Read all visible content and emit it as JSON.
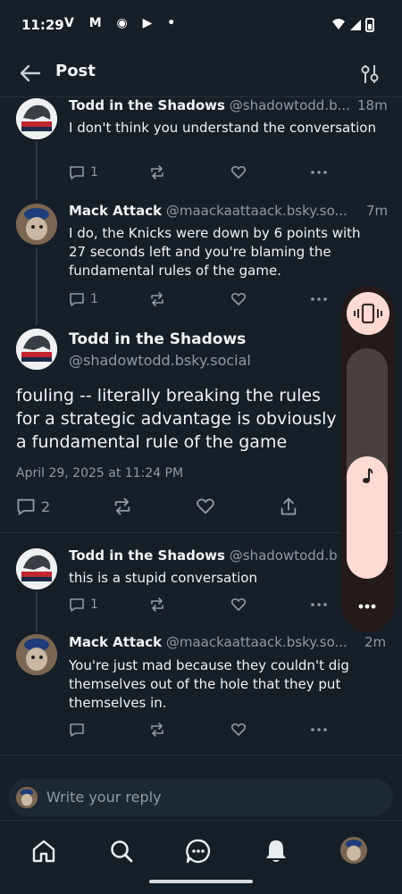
{
  "status_bar": {
    "time": "11:29",
    "icons": "V M ◉ ▶ •",
    "right_icons": "▾ ◢ ▮"
  },
  "header": {
    "title": "Post"
  },
  "posts": [
    {
      "name": "Todd in the Shadows",
      "handle": "@shadowtodd.b...",
      "time": "18m",
      "text": "I don't think you understand the conversation",
      "replies": "1"
    },
    {
      "name": "Mack Attack",
      "handle": "@maackaattaack.bsky.so...",
      "time": "7m",
      "text": "I do, the Knicks were down by 6 points with 27 seconds left and you're blaming the fundamental rules of the game.",
      "replies": "1"
    }
  ],
  "focus_post": {
    "name": "Todd in the Shadows",
    "handle": "@shadowtodd.bsky.social",
    "text": "fouling -- literally breaking the rules for a strategic advantage is obviously a fundamental rule of the game",
    "date": "April 29, 2025 at 11:24 PM",
    "replies": "2"
  },
  "replies_thread": [
    {
      "name": "Todd in the Shadows",
      "handle": "@shadowtodd.b",
      "time": "",
      "text": "this is a stupid conversation",
      "replies": "1"
    },
    {
      "name": "Mack Attack",
      "handle": "@maackaattaack.bsky.so...",
      "time": "2m",
      "text": "You're just mad because they couldn't dig themselves out of the hole that they put themselves in.",
      "replies": ""
    }
  ],
  "volume_panel": {
    "level": 0.53
  },
  "reply_bar": {
    "placeholder": "Write your reply"
  },
  "colors": {
    "background": "#161e27",
    "accent_panel": "#ffdad3",
    "muted": "#8f9aa6"
  }
}
